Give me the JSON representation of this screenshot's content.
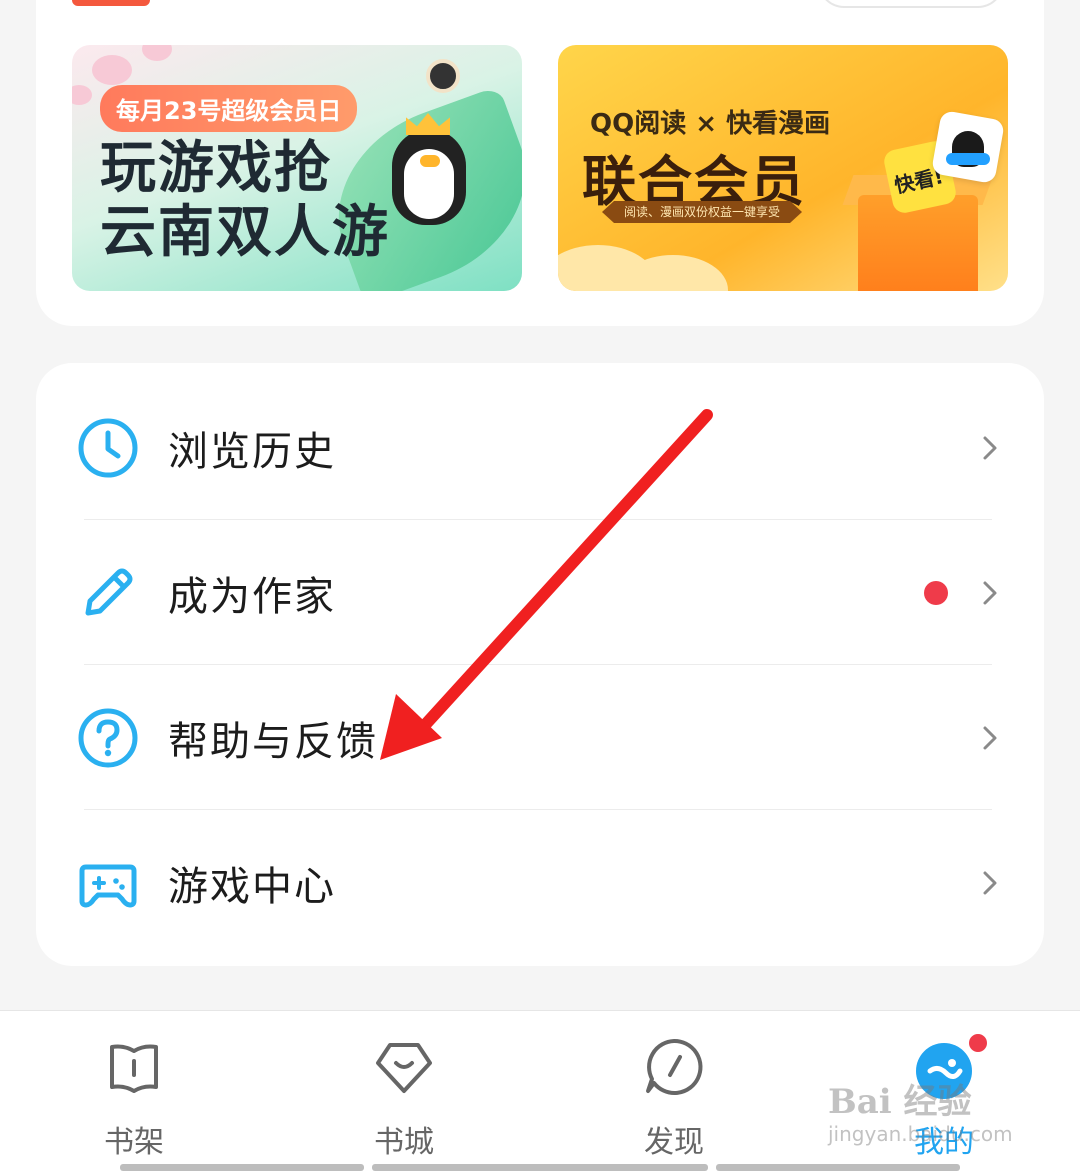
{
  "banners": {
    "left": {
      "tag": "每月23号超级会员日",
      "title_line1": "玩游戏抢",
      "title_line2": "云南双人游"
    },
    "right": {
      "subtitle": "QQ阅读 × 快看漫画",
      "title": "联合会员",
      "ribbon": "阅读、漫画双份权益一键享受",
      "tile_label": "快看!"
    }
  },
  "menu": {
    "items": [
      {
        "label": "浏览历史",
        "icon": "clock-icon"
      },
      {
        "label": "成为作家",
        "icon": "pencil-icon",
        "has_dot": true
      },
      {
        "label": "帮助与反馈",
        "icon": "question-circle-icon"
      },
      {
        "label": "游戏中心",
        "icon": "gamepad-icon"
      }
    ]
  },
  "bottom_nav": {
    "items": [
      {
        "label": "书架",
        "icon": "bookshelf-icon"
      },
      {
        "label": "书城",
        "icon": "bookstore-icon"
      },
      {
        "label": "发现",
        "icon": "compass-icon"
      },
      {
        "label": "我的",
        "icon": "profile-icon",
        "active": true,
        "badge": true
      }
    ]
  },
  "watermark": {
    "text": "Bai 经验",
    "sub": "jingyan.baidu.com"
  },
  "colors": {
    "accent": "#21a4f0",
    "badge_red": "#ef3b4a",
    "annotation_arrow": "#f02020"
  }
}
